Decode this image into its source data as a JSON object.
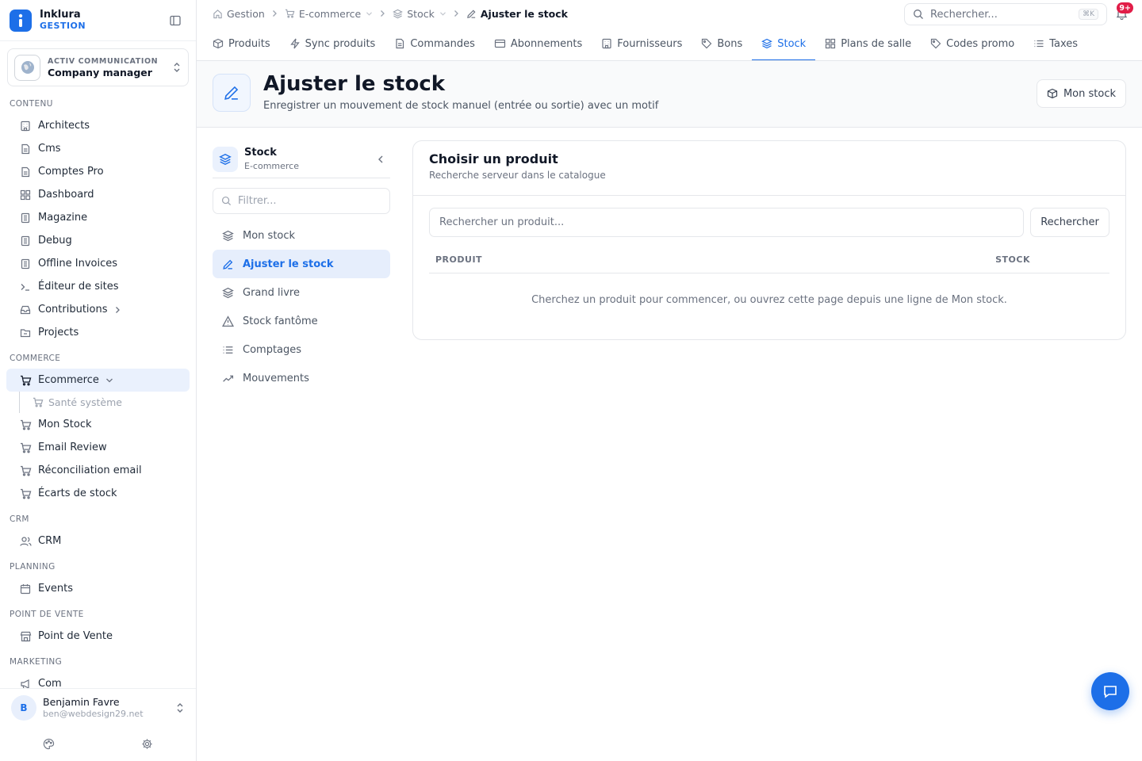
{
  "brand": {
    "name": "Inklura",
    "subtitle": "GESTION"
  },
  "company": {
    "org": "ACTIV COMMUNICATION",
    "role": "Company manager"
  },
  "sidebar": {
    "sections": [
      {
        "label": "CONTENU",
        "items": [
          {
            "label": "Architects",
            "icon": "building-icon"
          },
          {
            "label": "Cms",
            "icon": "document-icon"
          },
          {
            "label": "Comptes Pro",
            "icon": "document-icon"
          },
          {
            "label": "Dashboard",
            "icon": "grid-icon"
          },
          {
            "label": "Magazine",
            "icon": "book-icon"
          },
          {
            "label": "Debug",
            "icon": "book-icon"
          },
          {
            "label": "Offline Invoices",
            "icon": "book-icon"
          },
          {
            "label": "Éditeur de sites",
            "icon": "terminal-icon"
          },
          {
            "label": "Contributions",
            "icon": "inbox-icon"
          },
          {
            "label": "Projects",
            "icon": "folder-icon"
          }
        ]
      },
      {
        "label": "COMMERCE",
        "items": [
          {
            "label": "Ecommerce",
            "icon": "cart-icon"
          },
          {
            "label": "Santé système",
            "icon": "cart-icon"
          },
          {
            "label": "Mon Stock",
            "icon": "cart-icon"
          },
          {
            "label": "Email Review",
            "icon": "cart-icon"
          },
          {
            "label": "Réconciliation email",
            "icon": "cart-icon"
          },
          {
            "label": "Écarts de stock",
            "icon": "cart-icon"
          }
        ]
      },
      {
        "label": "CRM",
        "items": [
          {
            "label": "CRM",
            "icon": "users-icon"
          }
        ]
      },
      {
        "label": "PLANNING",
        "items": [
          {
            "label": "Events",
            "icon": "calendar-icon"
          }
        ]
      },
      {
        "label": "POINT DE VENTE",
        "items": [
          {
            "label": "Point de Vente",
            "icon": "store-icon"
          }
        ]
      },
      {
        "label": "MARKETING",
        "items": [
          {
            "label": "Com",
            "icon": "megaphone-icon"
          }
        ]
      }
    ]
  },
  "user": {
    "initial": "B",
    "name": "Benjamin Favre",
    "email": "ben@webdesign29.net"
  },
  "breadcrumb": [
    {
      "label": "Gestion",
      "icon": "home-icon"
    },
    {
      "label": "E-commerce",
      "icon": "cart-icon"
    },
    {
      "label": "Stock",
      "icon": "layers-icon"
    },
    {
      "label": "Ajuster le stock",
      "icon": "pencil-icon"
    }
  ],
  "search": {
    "placeholder": "Rechercher...",
    "shortcut": "⌘K"
  },
  "notifications": {
    "badge": "9+"
  },
  "tabs": [
    {
      "label": "Produits",
      "icon": "box-icon"
    },
    {
      "label": "Sync produits",
      "icon": "bolt-icon"
    },
    {
      "label": "Commandes",
      "icon": "document-icon"
    },
    {
      "label": "Abonnements",
      "icon": "card-icon"
    },
    {
      "label": "Fournisseurs",
      "icon": "building-icon"
    },
    {
      "label": "Bons",
      "icon": "tag-icon"
    },
    {
      "label": "Stock",
      "icon": "layers-icon",
      "active": true
    },
    {
      "label": "Plans de salle",
      "icon": "grid-icon"
    },
    {
      "label": "Codes promo",
      "icon": "tag-icon"
    },
    {
      "label": "Taxes",
      "icon": "list-icon"
    }
  ],
  "page": {
    "title": "Ajuster le stock",
    "subtitle": "Enregistrer un mouvement de stock manuel (entrée ou sortie) avec un motif",
    "action_label": "Mon stock"
  },
  "subnav": {
    "title": "Stock",
    "subtitle": "E-commerce",
    "filter_placeholder": "Filtrer...",
    "items": [
      {
        "label": "Mon stock",
        "icon": "layers-icon"
      },
      {
        "label": "Ajuster le stock",
        "icon": "pencil-icon",
        "active": true
      },
      {
        "label": "Grand livre",
        "icon": "layers-icon"
      },
      {
        "label": "Stock fantôme",
        "icon": "warning-icon"
      },
      {
        "label": "Comptages",
        "icon": "list-icon"
      },
      {
        "label": "Mouvements",
        "icon": "trend-icon"
      }
    ]
  },
  "card": {
    "title": "Choisir un produit",
    "subtitle": "Recherche serveur dans le catalogue",
    "search_placeholder": "Rechercher un produit...",
    "search_button": "Rechercher",
    "col_product": "PRODUIT",
    "col_stock": "STOCK",
    "empty": "Cherchez un produit pour commencer, ou ouvrez cette page depuis une ligne de Mon stock."
  },
  "colors": {
    "accent": "#1d6fe8",
    "badge": "#e11d48"
  }
}
